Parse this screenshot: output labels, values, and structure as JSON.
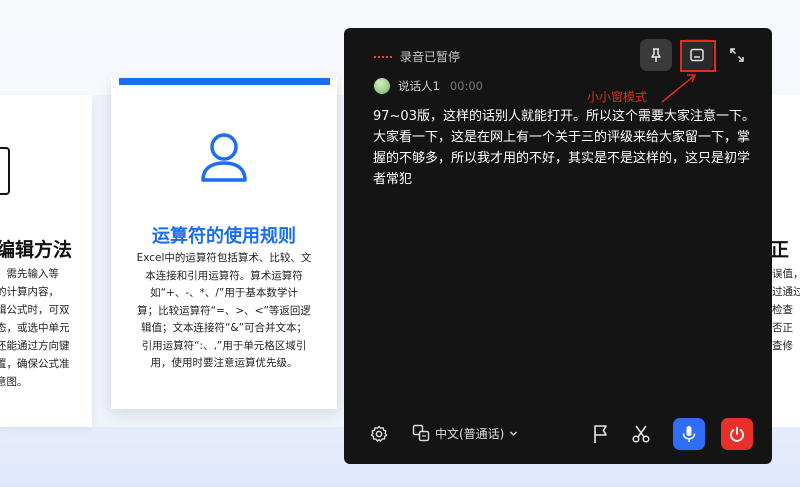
{
  "slides": {
    "left": {
      "title": "编辑方法",
      "body_lines": [
        "，需先输入等",
        "的计算内容，",
        "辑公式时，可双",
        "态，或选中单元",
        "还能通过方向键",
        "置，确保公式准",
        "意图。"
      ]
    },
    "center": {
      "title": "运算符的使用规则",
      "body_lines": [
        "Excel中的运算符包括算术、比较、文",
        "本连接和引用运算符。算术运算符",
        "如“+、-、*、/”用于基本数学计",
        "算；比较运算符“=、>、<”等返回逻",
        "辑值；文本连接符“&”可合并文本；",
        "引用运算符“:、,”用于单元格区域引",
        "用，使用时要注意运算优先级。"
      ],
      "accent_color": "#1a6ef0"
    },
    "right": {
      "title": "正",
      "body_lines": [
        "误值，",
        "过通过",
        "检查",
        "否正",
        "查修"
      ]
    }
  },
  "recorder": {
    "status_text": "录音已暂停",
    "speaker_name": "说话人1",
    "speaker_time": "00:00",
    "annotation": "小小窗模式",
    "transcript_lines": [
      "97~03版，这样的话别人就能打开。所以这个需要大家注意一下。",
      "大家看一下，这是在网上有一个关于三的评级来给大家留一下，掌",
      "握的不够多，所以我才用的不好，其实是不是这样的，这只是初学",
      "者常犯"
    ],
    "language": "中文(普通话)",
    "icons": {
      "pin": "pin-icon",
      "mini": "mini-window-icon",
      "expand": "expand-icon",
      "settings": "gear-icon",
      "translate": "translate-icon",
      "flag": "flag-icon",
      "cut": "scissors-icon",
      "mic": "microphone-icon",
      "power": "power-icon"
    },
    "colors": {
      "panel": "#141414",
      "mic_button": "#2f6ef6",
      "stop_button": "#e8302a",
      "highlight": "#e52a1f"
    }
  }
}
